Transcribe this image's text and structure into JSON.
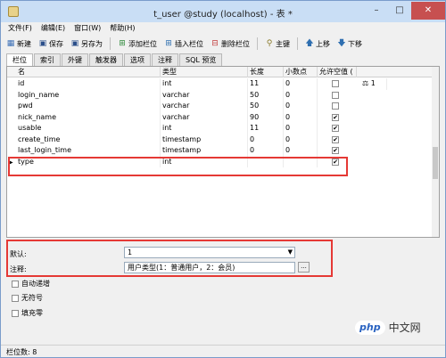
{
  "window": {
    "title": "t_user @study (localhost) - 表 *"
  },
  "menu": [
    "文件(F)",
    "编辑(E)",
    "窗口(W)",
    "帮助(H)"
  ],
  "toolbar": {
    "new": "新建",
    "save": "保存",
    "save_as": "另存为",
    "add_field": "添加栏位",
    "insert_field": "插入栏位",
    "delete_field": "删除栏位",
    "primary_key": "主键",
    "move_up": "上移",
    "move_down": "下移"
  },
  "tabs": [
    "栏位",
    "索引",
    "外键",
    "触发器",
    "选项",
    "注释",
    "SQL 预览"
  ],
  "grid": {
    "headers": [
      "名",
      "类型",
      "长度",
      "小数点",
      "允许空值 ("
    ],
    "rows": [
      {
        "name": "id",
        "type": "int",
        "length": "11",
        "decimals": "0",
        "nullable": false,
        "key": "1"
      },
      {
        "name": "login_name",
        "type": "varchar",
        "length": "50",
        "decimals": "0",
        "nullable": false,
        "key": ""
      },
      {
        "name": "pwd",
        "type": "varchar",
        "length": "50",
        "decimals": "0",
        "nullable": false,
        "key": ""
      },
      {
        "name": "nick_name",
        "type": "varchar",
        "length": "90",
        "decimals": "0",
        "nullable": true,
        "key": ""
      },
      {
        "name": "usable",
        "type": "int",
        "length": "11",
        "decimals": "0",
        "nullable": true,
        "key": ""
      },
      {
        "name": "create_time",
        "type": "timestamp",
        "length": "0",
        "decimals": "0",
        "nullable": true,
        "key": ""
      },
      {
        "name": "last_login_time",
        "type": "timestamp",
        "length": "0",
        "decimals": "0",
        "nullable": true,
        "key": ""
      },
      {
        "name": "type",
        "type": "int",
        "length": "",
        "decimals": "",
        "nullable": true,
        "key": ""
      }
    ]
  },
  "props": {
    "default_label": "默认:",
    "default_value": "1",
    "comment_label": "注释:",
    "comment_value": "用户类型(1：普通用户，2：会员)",
    "ellipsis": "..."
  },
  "options": [
    "自动递增",
    "无符号",
    "填充零"
  ],
  "status": {
    "field_count": "栏位数: 8"
  },
  "watermark": {
    "logo": "php",
    "text": "中文网"
  },
  "colors": {
    "highlight": "#e53935",
    "titlebar": "#c9def5",
    "close": "#c75050"
  }
}
